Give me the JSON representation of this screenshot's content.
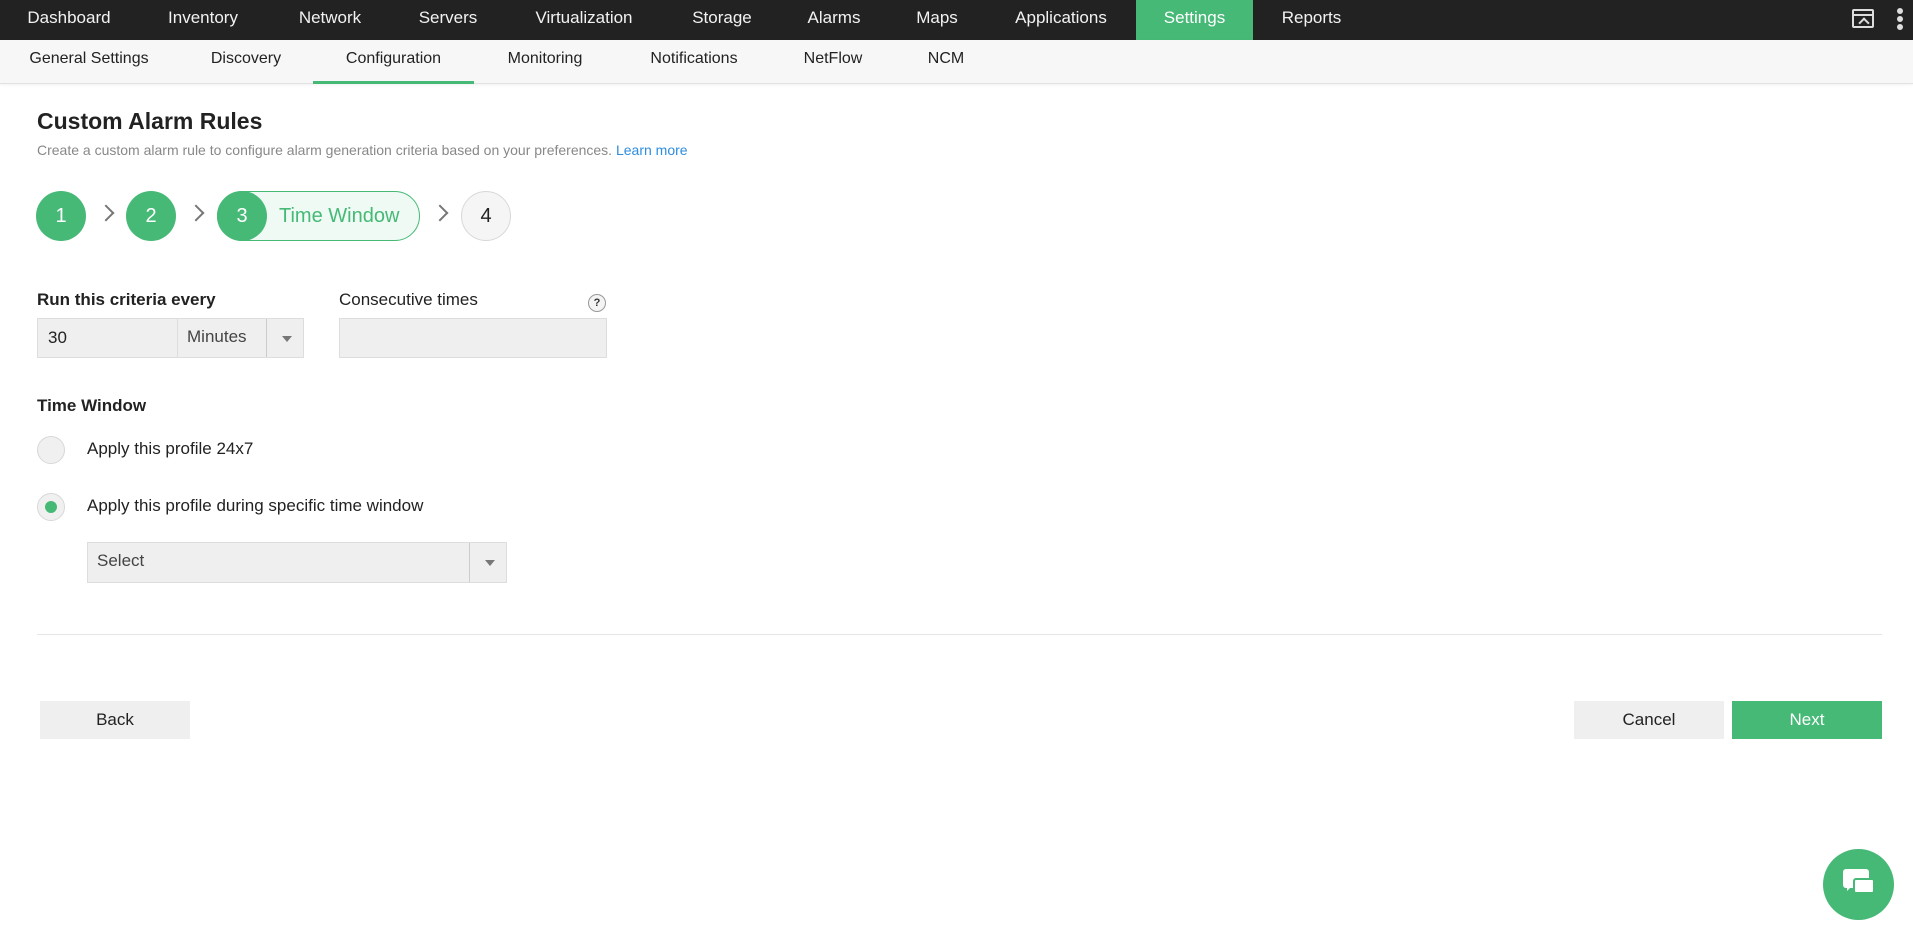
{
  "colors": {
    "accent": "#46b977",
    "topnav_bg": "#222222",
    "link": "#2d8de0"
  },
  "topnav": {
    "items": [
      {
        "label": "Dashboard"
      },
      {
        "label": "Inventory"
      },
      {
        "label": "Network"
      },
      {
        "label": "Servers"
      },
      {
        "label": "Virtualization"
      },
      {
        "label": "Storage"
      },
      {
        "label": "Alarms"
      },
      {
        "label": "Maps"
      },
      {
        "label": "Applications"
      },
      {
        "label": "Settings"
      },
      {
        "label": "Reports"
      }
    ],
    "active": "Settings",
    "icons": [
      "window-icon",
      "kebab-menu-icon"
    ]
  },
  "subnav": {
    "items": [
      {
        "label": "General Settings"
      },
      {
        "label": "Discovery"
      },
      {
        "label": "Configuration"
      },
      {
        "label": "Monitoring"
      },
      {
        "label": "Notifications"
      },
      {
        "label": "NetFlow"
      },
      {
        "label": "NCM"
      }
    ],
    "active": "Configuration"
  },
  "page": {
    "title": "Custom Alarm Rules",
    "description": "Create a custom alarm rule to configure alarm generation criteria based on your preferences.",
    "learn_more": "Learn more"
  },
  "stepper": {
    "steps": [
      {
        "number": "1",
        "state": "done"
      },
      {
        "number": "2",
        "state": "done"
      },
      {
        "number": "3",
        "state": "current",
        "label": "Time Window"
      },
      {
        "number": "4",
        "state": "pending"
      }
    ]
  },
  "form": {
    "run_label": "Run this criteria every",
    "run_value": "30",
    "run_unit": "Minutes",
    "consecutive_label": "Consecutive times",
    "consecutive_value": "",
    "help_glyph": "?",
    "time_window_label": "Time Window",
    "options": [
      {
        "label": "Apply this profile 24x7",
        "checked": false
      },
      {
        "label": "Apply this profile during specific time window",
        "checked": true
      }
    ],
    "time_window_select": "Select"
  },
  "actions": {
    "back": "Back",
    "cancel": "Cancel",
    "next": "Next"
  },
  "chat": {
    "icon": "chat-icon"
  }
}
